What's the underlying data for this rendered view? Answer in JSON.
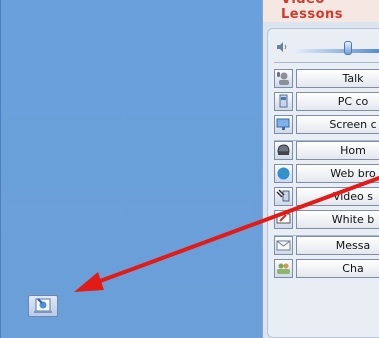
{
  "panel": {
    "title": "Video Lessons"
  },
  "volume": {
    "level": 0.62
  },
  "groups": [
    {
      "items": [
        {
          "key": "talk",
          "label": "Talk",
          "icon": "microphone-user-icon"
        },
        {
          "key": "pc-control",
          "label": "PC co",
          "icon": "pc-control-icon"
        },
        {
          "key": "screen",
          "label": "Screen c",
          "icon": "screen-monitor-icon"
        }
      ]
    },
    {
      "items": [
        {
          "key": "home",
          "label": "Hom",
          "icon": "home-helmet-icon"
        },
        {
          "key": "web",
          "label": "Web bro",
          "icon": "globe-icon"
        },
        {
          "key": "video",
          "label": "Video s",
          "icon": "video-stream-icon"
        },
        {
          "key": "whiteboard",
          "label": "White b",
          "icon": "whiteboard-pen-icon"
        }
      ]
    },
    {
      "items": [
        {
          "key": "message",
          "label": "Messa",
          "icon": "envelope-icon"
        },
        {
          "key": "chat",
          "label": "Cha",
          "icon": "people-chat-icon"
        }
      ]
    }
  ],
  "colors": {
    "desktop": "#6aa0dc",
    "arrow": "#e31b17",
    "accent_red": "#d13b2b"
  }
}
